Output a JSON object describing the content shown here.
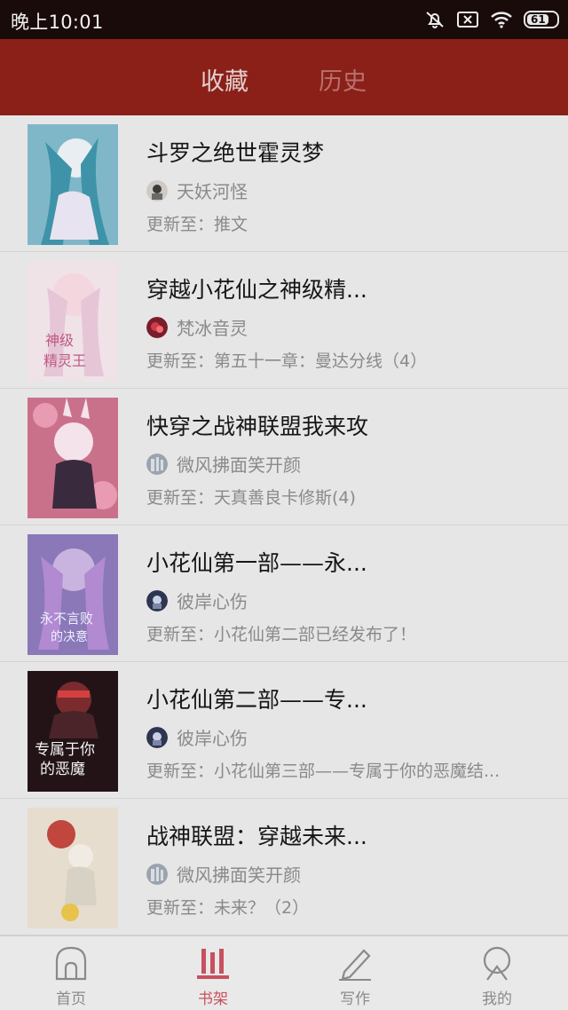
{
  "status": {
    "time": "晚上10:01",
    "battery": "61"
  },
  "header": {
    "tabs": [
      "收藏",
      "历史"
    ]
  },
  "books": [
    {
      "title": "斗罗之绝世霍灵梦",
      "author": "天妖河怪",
      "update": "更新至：推文"
    },
    {
      "title": "穿越小花仙之神级精...",
      "author": "梵冰音灵",
      "update": "更新至：第五十一章：曼达分线（4）"
    },
    {
      "title": "快穿之战神联盟我来攻",
      "author": "微风拂面笑开颜",
      "update": "更新至：天真善良卡修斯(4)"
    },
    {
      "title": "小花仙第一部——永...",
      "author": "彼岸心伤",
      "update": "更新至：小花仙第二部已经发布了！"
    },
    {
      "title": "小花仙第二部——专...",
      "author": "彼岸心伤",
      "update": "更新至：小花仙第三部——专属于你的恶魔结..."
    },
    {
      "title": "战神联盟：穿越未来...",
      "author": "微风拂面笑开颜",
      "update": "更新至：未来？（2）"
    }
  ],
  "nav": [
    {
      "label": "首页",
      "icon": "home-icon"
    },
    {
      "label": "书架",
      "icon": "bookshelf-icon"
    },
    {
      "label": "写作",
      "icon": "pen-icon"
    },
    {
      "label": "我的",
      "icon": "profile-icon"
    }
  ],
  "colors": {
    "accent": "#8b2019",
    "active_tab": "#c8515f"
  }
}
